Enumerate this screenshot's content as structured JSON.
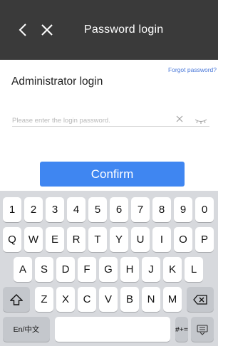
{
  "header": {
    "title": "Password login",
    "back_icon": "chevron-left-icon",
    "close_icon": "close-icon"
  },
  "form": {
    "forgot_link": "Forgot password?",
    "section_title": "Administrator login",
    "password_placeholder": "Please enter the login password.",
    "password_value": "",
    "clear_icon": "clear-icon",
    "visibility_icon": "eye-closed-icon",
    "confirm_label": "Confirm"
  },
  "keyboard": {
    "row1": [
      "1",
      "2",
      "3",
      "4",
      "5",
      "6",
      "7",
      "8",
      "9",
      "0"
    ],
    "row2": [
      "Q",
      "W",
      "E",
      "R",
      "T",
      "Y",
      "U",
      "I",
      "O",
      "P"
    ],
    "row3": [
      "A",
      "S",
      "D",
      "F",
      "G",
      "H",
      "J",
      "K",
      "L"
    ],
    "row4": [
      "Z",
      "X",
      "C",
      "V",
      "B",
      "N",
      "M"
    ],
    "shift_icon": "shift-icon",
    "backspace_icon": "backspace-icon",
    "lang_label": "En/中文",
    "space_label": "",
    "symbols_label": "#+=",
    "hide_keyboard_icon": "keyboard-hide-icon"
  },
  "colors": {
    "header_bg": "#3a3a3a",
    "accent": "#3f86f1",
    "link": "#4a78d8",
    "keyboard_bg": "#d7d9dd"
  }
}
